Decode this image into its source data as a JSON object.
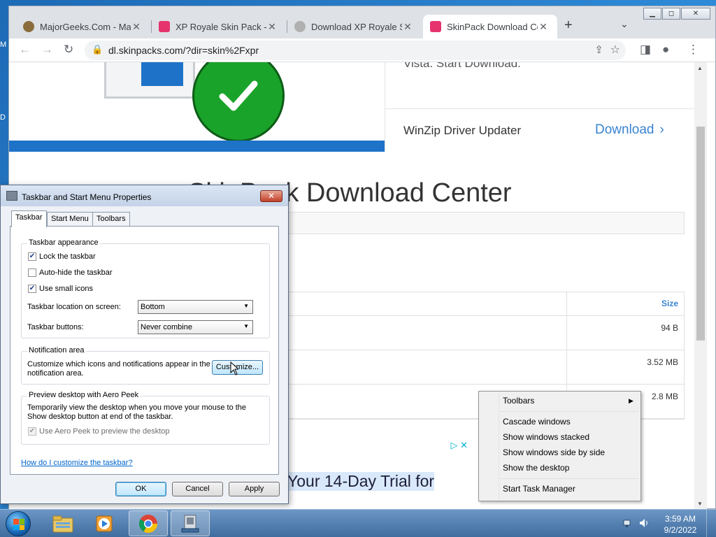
{
  "desktop": {
    "left_marks": [
      "M",
      "D"
    ]
  },
  "browser": {
    "tabs": [
      {
        "title": "MajorGeeks.Com - MajorGeeks",
        "favicon_color": "#8a6d3b"
      },
      {
        "title": "XP Royale Skin Pack - SkinPack",
        "favicon_color": "#e6336e"
      },
      {
        "title": "Download XP Royale Skin Pack",
        "favicon_color": "#b0b0b0"
      },
      {
        "title": "SkinPack Download Center",
        "favicon_color": "#e6336e"
      }
    ],
    "close_glyph": "✕",
    "new_tab_glyph": "+",
    "tab_menu_glyph": "⌄",
    "window_controls": {
      "minimize": "▁",
      "maximize": "◻",
      "close": "✕"
    },
    "toolbar": {
      "back": "←",
      "forward": "→",
      "reload": "↻",
      "url": "dl.skinpacks.com/?dir=skin%2Fxpr",
      "lock": "🔒",
      "share": "⇪",
      "star": "☆",
      "sidepanel": "◨",
      "profile": "●",
      "menu": "⋮"
    }
  },
  "page": {
    "ad_top_text": "Vista. Start Download.",
    "ad_item": "WinZip Driver Updater",
    "ad_download": "Download",
    "ad_chevron": "›",
    "heading": "SkinPack Download Center",
    "table": {
      "size_header": "Size",
      "sizes": [
        "94 B",
        "3.52 MB",
        "2.8 MB"
      ]
    },
    "ad_bottom": "Your 14-Day Trial for",
    "ad_choices": "▷ ✕"
  },
  "dialog": {
    "title": "Taskbar and Start Menu Properties",
    "close": "✕",
    "tabs": [
      "Taskbar",
      "Start Menu",
      "Toolbars"
    ],
    "taskbar_appearance": {
      "label": "Taskbar appearance",
      "lock": {
        "label": "Lock the taskbar",
        "checked": "✔"
      },
      "autohide": {
        "label": "Auto-hide the taskbar",
        "checked": ""
      },
      "small_icons": {
        "label": "Use small icons",
        "checked": "✔"
      },
      "location_label": "Taskbar location on screen:",
      "location_value": "Bottom",
      "buttons_label": "Taskbar buttons:",
      "buttons_value": "Never combine",
      "arrow": "▼"
    },
    "notification": {
      "label": "Notification area",
      "text": "Customize which icons and notifications appear in the notification area.",
      "button": "Customize..."
    },
    "aero_peek": {
      "label": "Preview desktop with Aero Peek",
      "text": "Temporarily view the desktop when you move your mouse to the Show desktop button at end of the taskbar.",
      "checkbox": {
        "label": "Use Aero Peek to preview the desktop",
        "checked": "✔"
      }
    },
    "help_link": "How do I customize the taskbar?",
    "buttons": {
      "ok": "OK",
      "cancel": "Cancel",
      "apply": "Apply"
    }
  },
  "context_menu": {
    "items": [
      "Toolbars",
      "Cascade windows",
      "Show windows stacked",
      "Show windows side by side",
      "Show the desktop",
      "Start Task Manager"
    ],
    "submenu_arrow": "▶"
  },
  "taskbar": {
    "clock_time": "3:59 AM",
    "clock_date": "9/2/2022"
  },
  "colors": {
    "accent_blue": "#1e73c8",
    "check_green": "#1aa32a",
    "link_blue": "#3b83d1"
  }
}
